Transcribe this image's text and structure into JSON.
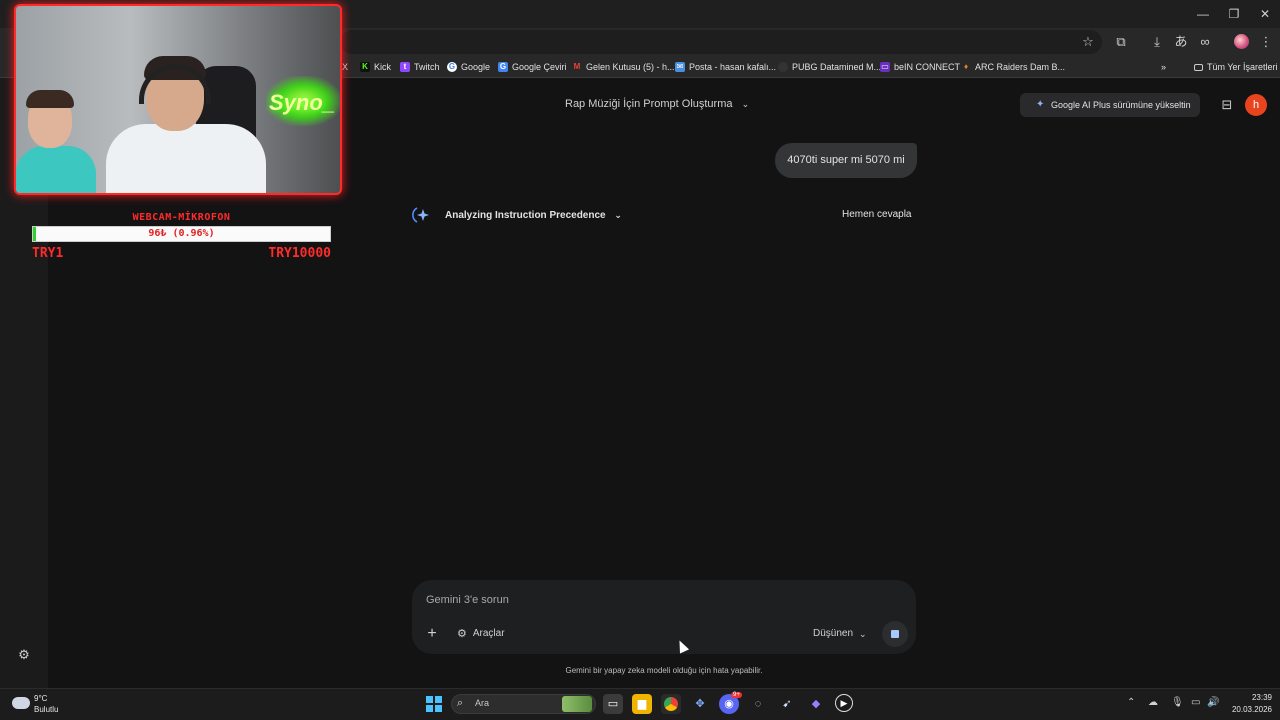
{
  "browser": {
    "window_controls": {
      "minimize": "—",
      "restore": "❐",
      "close": "✕"
    },
    "toolbar_icons": [
      "star-icon",
      "extensions-icon",
      "download-icon",
      "translate-icon",
      "link-icon",
      "profile-icon",
      "menu-icon"
    ],
    "bookmarks": [
      {
        "label": "X",
        "icon": "x-icon",
        "color": "#ffffff"
      },
      {
        "label": "Kick",
        "icon": "kick-icon",
        "color": "#53fc18"
      },
      {
        "label": "Twitch",
        "icon": "twitch-icon",
        "color": "#9146ff"
      },
      {
        "label": "Google",
        "icon": "google-icon",
        "color": "#4285f4"
      },
      {
        "label": "Google Çeviri",
        "icon": "translate-icon",
        "color": "#4285f4"
      },
      {
        "label": "Gelen Kutusu (5) - h...",
        "icon": "gmail-icon",
        "color": "#ea4335"
      },
      {
        "label": "Posta - hasan kafalı...",
        "icon": "mail-icon",
        "color": "#4a90e2"
      },
      {
        "label": "PUBG Datamined M...",
        "icon": "pubg-icon",
        "color": "#333333"
      },
      {
        "label": "beIN CONNECT",
        "icon": "bein-icon",
        "color": "#6b2fbf"
      },
      {
        "label": "ARC Raiders Dam B...",
        "icon": "arc-icon",
        "color": "#e0852a"
      }
    ],
    "bookmarks_overflow": "»",
    "all_bookmarks": "Tüm Yer İşaretleri"
  },
  "gemini": {
    "conversation_title": "Rap Müziği İçin Prompt Oluşturma",
    "upgrade_label": "Google AI Plus sürümüne yükseltin",
    "avatar_letter": "h",
    "user_message": "4070ti super mi 5070 mi",
    "thinking_label": "Analyzing Instruction Precedence",
    "answer_now": "Hemen cevapla",
    "prompt_placeholder": "Gemini 3'e sorun",
    "tools_label": "Araçlar",
    "mode_label": "Düşünen",
    "disclaimer": "Gemini bir yapay zeka modeli olduğu için hata yapabilir."
  },
  "overlay": {
    "webcam_neon": "Syno_",
    "goal_title": "WEBCAM-MİKROFON",
    "goal_progress_text": "96₺ (0.96%)",
    "goal_progress_fraction": 0.0096,
    "goal_min": "TRY1",
    "goal_max": "TRY10000"
  },
  "taskbar": {
    "weather_temp": "9°C",
    "weather_condition": "Bulutlu",
    "search_placeholder": "Ara",
    "apps": [
      "task-view-icon",
      "file-explorer-icon",
      "chrome-icon",
      "app-icon",
      "discord-icon",
      "app-icon-2",
      "steam-icon",
      "app-icon-3",
      "media-player-icon"
    ],
    "discord_badge": "9+",
    "clock_time": "23:39",
    "clock_date": "20.03.2026"
  }
}
